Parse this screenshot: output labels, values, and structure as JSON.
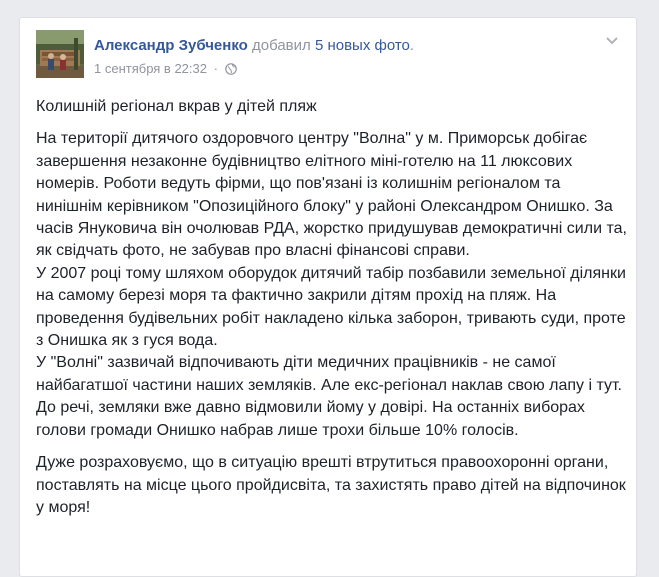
{
  "post": {
    "author": "Александр Зубченко",
    "action": " добавил ",
    "photos_link": "5 новых фото",
    "action_end": ".",
    "timestamp": "1 сентября в 22:32",
    "meta_separator": "·",
    "privacy_icon": "globe-icon",
    "menu_icon": "chevron-down-icon",
    "paragraphs": [
      "Колишній регіонал вкрав у дітей пляж",
      "На території дитячого оздоровчого центру \"Волна\" у м. Приморськ добігає завершення незаконне будівництво елітного міні-готелю на 11 люксових номерів. Роботи ведуть фірми, що пов'язані із колишнім регіоналом та нинішнім керівником \"Опозиційного блоку\" у районі Олександром Онишко. За часів Януковича він очолював РДА, жорстко придушував демократичні сили та, як свідчать фото, не забував про власні фінансові справи.",
      "У 2007 році тому шляхом оборудок дитячий табір позбавили земельної ділянки на самому березі моря та фактично закрили дітям прохід на пляж. На проведення будівельних робіт накладено кілька заборон, тривають суди, проте з Онишка як з гуся вода.",
      "У \"Волні\" зазвичай відпочивають діти медичних працівників - не самої найбагатшої частини наших земляків. Але екс-регіонал наклав свою лапу і тут. До речі, земляки вже давно відмовили йому у довірі. На останніх виборах голови громади Онишко набрав лише трохи більше 10% голосів.",
      "Дуже розраховуємо, що в ситуацію врешті втрутиться правоохоронні органи, поставлять на місце цього пройдисвіта, та захистять право дітей на відпочинок у моря!"
    ]
  },
  "colors": {
    "link": "#365899",
    "muted": "#90949c",
    "text": "#1d2129",
    "background": "#e9ebee",
    "card": "#ffffff"
  }
}
